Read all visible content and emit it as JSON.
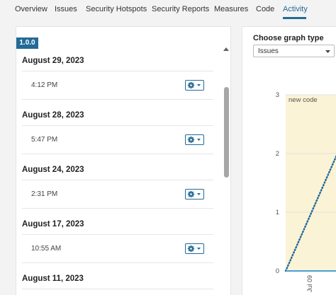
{
  "nav": {
    "tabs": [
      {
        "label": "Overview"
      },
      {
        "label": "Issues"
      },
      {
        "label": "Security Hotspots"
      },
      {
        "label": "Security Reports"
      },
      {
        "label": "Measures"
      },
      {
        "label": "Code"
      },
      {
        "label": "Activity",
        "active": true
      }
    ]
  },
  "activity": {
    "version_badge": "1.0.0",
    "days": [
      {
        "date": "August 29, 2023",
        "time": "4:12 PM"
      },
      {
        "date": "August 28, 2023",
        "time": "5:47 PM"
      },
      {
        "date": "August 24, 2023",
        "time": "2:31 PM"
      },
      {
        "date": "August 17, 2023",
        "time": "10:55 AM"
      },
      {
        "date": "August 11, 2023",
        "time": ""
      }
    ],
    "action_icon": "gear-icon"
  },
  "graph": {
    "label": "Choose graph type",
    "selected": "Issues"
  },
  "chart_data": {
    "type": "line",
    "annotations": [
      "new code"
    ],
    "y_ticks": [
      "3",
      "2",
      "1",
      "0"
    ],
    "x_ticks": [
      "Jul 09"
    ],
    "ylim": [
      0,
      3
    ],
    "new_code_region_color": "#fbf3d5",
    "series": [
      {
        "line_style": "dotted",
        "color": "#236a97",
        "points": [
          [
            0,
            0
          ],
          [
            1,
            2
          ]
        ]
      },
      {
        "line_style": "solid",
        "color": "#4b9fd5",
        "points": [
          [
            0,
            0
          ],
          [
            1,
            0
          ]
        ]
      }
    ]
  },
  "colors": {
    "accent": "#236a97",
    "new_code_bg": "#fbf3d5"
  }
}
